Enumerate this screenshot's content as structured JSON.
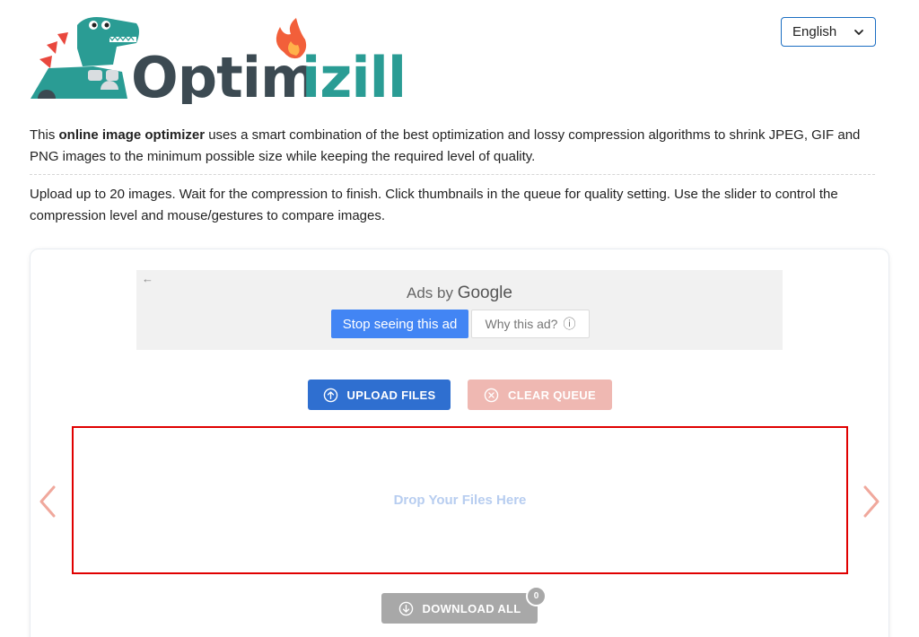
{
  "header": {
    "logo_text": "Optimizilla",
    "language": "English"
  },
  "intro": {
    "line1_prefix": "This ",
    "line1_bold": "online image optimizer",
    "line1_suffix": " uses a smart combination of the best optimization and lossy compression algorithms to shrink JPEG, GIF and PNG images to the minimum possible size while keeping the required level of quality.",
    "line2": "Upload up to 20 images. Wait for the compression to finish. Click thumbnails in the queue for quality setting. Use the slider to control the compression level and mouse/gestures to compare images."
  },
  "ad": {
    "back": "←",
    "ads_by": "Ads by ",
    "google": "Google",
    "stop_label": "Stop seeing this ad",
    "why_label": "Why this ad?",
    "info_glyph": "ⓘ"
  },
  "toolbar": {
    "upload_label": "UPLOAD FILES",
    "clear_label": "CLEAR QUEUE",
    "download_label": "DOWNLOAD ALL",
    "download_count": "0"
  },
  "dropzone": {
    "text": "Drop Your Files Here"
  },
  "colors": {
    "primary": "#2f6fd0",
    "clear": "#efb8b2",
    "download": "#a8a8a8",
    "arrow": "#f0a89c",
    "drop_border": "#e00000",
    "logo_teal": "#2a9c94",
    "logo_dark": "#3c4a52"
  }
}
